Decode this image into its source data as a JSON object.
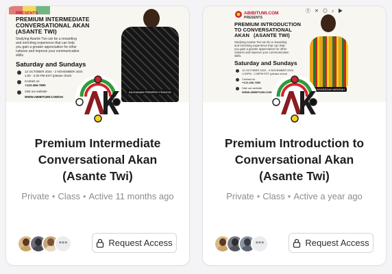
{
  "courses": [
    {
      "title": "Premium Intermediate Conversational Akan (Asante Twi)",
      "meta": {
        "visibility": "Private",
        "kind": "Class",
        "activity": "Active 11 months ago"
      },
      "button_label": "Request Access",
      "more_label": "•••",
      "banner": {
        "presents": "PRESENTS",
        "title_line1": "PREMIUM INTERMEDIATE",
        "title_line2": "CONVERSATIONAL AKAN",
        "title_line3": "(ASANTE TWI)",
        "description_line1": "Studying Asante Twi can be a rewarding",
        "description_line2": "and enriching experience that can help",
        "description_line3": "you gain a greater appreciation for other",
        "description_line4": "cultures and improve your communication",
        "description_line5": "skills.",
        "schedule": "Saturday and Sundays",
        "dates": "12 OCTOBER 2024 - 2 NOVEMBER 2024",
        "time": "1:00 - 2:30 PM EST (please check",
        "contact_label": "Contact us",
        "phone": "+123-456-7890",
        "website_label": "Visit our website",
        "website": "WWW.ABIBITUMI.COM/AK",
        "person_tag": "ADJOAMAN PREMPEH FRANCIS"
      },
      "avatars": [
        {
          "name": "member-avatar-1",
          "head": "#5a3a22",
          "body": "#c9a36a",
          "bg": "#d9b98a"
        },
        {
          "name": "member-avatar-2",
          "head": "#2d2d33",
          "body": "#4a4a55",
          "bg": "#6d6d77"
        },
        {
          "name": "member-avatar-3",
          "head": "#7a5233",
          "body": "#e8d9c2",
          "bg": "#c8a57d"
        }
      ]
    },
    {
      "title": "Premium Introduction to Conversational Akan (Asante Twi)",
      "meta": {
        "visibility": "Private",
        "kind": "Class",
        "activity": "Active a year ago"
      },
      "button_label": "Request Access",
      "more_label": "•••",
      "banner": {
        "brand": "ABIBITUMI.COM",
        "presents": "PRESENTS",
        "title_line1": "PREMIUM INTRODUCTION",
        "title_line2": "TO CONVERSATIONAL",
        "title_line3": "AKAN",
        "title_line4": "(ASANTE TWI)",
        "description_line1": "Studying Asante Twi can be a rewarding",
        "description_line2": "and enriching experience that can help",
        "description_line3": "you gain a greater appreciation for other",
        "description_line4": "cultures and improve your communication",
        "description_line5": "skills.",
        "schedule": "Saturday and Sundays",
        "dates": "12 OCTOBER 2024 - 2 NOVEMBER 2024",
        "time": "1:00PM - 2:30PM EST (please check",
        "contact_label": "Contact us",
        "phone": "+123-456-7890",
        "website_label": "Visit our website",
        "website": "WWW.ABIBITUMI.COM",
        "person_tag": "AFIA NYARKOAH MENSAH"
      },
      "avatars": [
        {
          "name": "member-avatar-1",
          "head": "#5a3a22",
          "body": "#c9a36a",
          "bg": "#d9b98a"
        },
        {
          "name": "member-avatar-2",
          "head": "#2d2d33",
          "body": "#555560",
          "bg": "#7a7a82"
        },
        {
          "name": "member-avatar-3",
          "head": "#3a3a44",
          "body": "#5c6470",
          "bg": "#8a94a0"
        }
      ]
    }
  ]
}
